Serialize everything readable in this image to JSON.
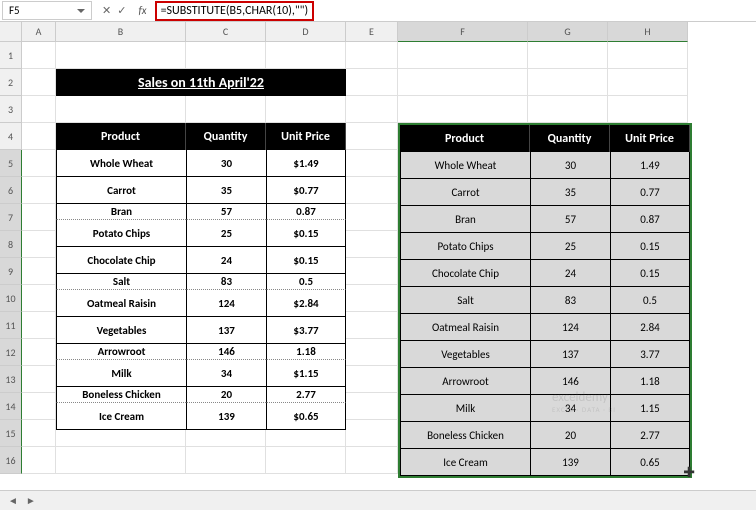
{
  "namebox": {
    "value": "F5"
  },
  "formula_bar": {
    "fx_label": "fx",
    "formula": "=SUBSTITUTE(B5,CHAR(10),\"\")"
  },
  "columns": [
    "A",
    "B",
    "C",
    "D",
    "E",
    "F",
    "G",
    "H"
  ],
  "rows": [
    "1",
    "2",
    "3",
    "4",
    "5",
    "6",
    "7",
    "8",
    "9",
    "10",
    "11",
    "12",
    "13",
    "14",
    "15",
    "16"
  ],
  "title": "Sales on 11th April'22",
  "table1": {
    "headers": {
      "product": "Product",
      "quantity": "Quantity",
      "unitprice": "Unit Price"
    },
    "rows": [
      {
        "p": "Whole Wheat",
        "q": "30",
        "u": "$1.49"
      },
      {
        "p": "Carrot",
        "q": "35",
        "u": "$0.77"
      },
      {
        "p": "Bran",
        "q": "57",
        "u": "0.87",
        "squish": true
      },
      {
        "p": "Potato Chips",
        "q": "25",
        "u": "$0.15"
      },
      {
        "p": "Chocolate Chip",
        "q": "24",
        "u": "$0.15"
      },
      {
        "p": "Salt",
        "q": "83",
        "u": "0.5",
        "squish": true
      },
      {
        "p": "Oatmeal Raisin",
        "q": "124",
        "u": "$2.84"
      },
      {
        "p": "Vegetables",
        "q": "137",
        "u": "$3.77"
      },
      {
        "p": "Arrowroot",
        "q": "146",
        "u": "1.18",
        "squish": true
      },
      {
        "p": "Milk",
        "q": "34",
        "u": "$1.15"
      },
      {
        "p": "Boneless Chicken",
        "q": "20",
        "u": "2.77",
        "squish": true
      },
      {
        "p": "Ice Cream",
        "q": "139",
        "u": "$0.65"
      }
    ]
  },
  "table2": {
    "headers": {
      "product": "Product",
      "quantity": "Quantity",
      "unitprice": "Unit Price"
    },
    "rows": [
      {
        "p": "Whole Wheat",
        "q": "30",
        "u": "1.49"
      },
      {
        "p": "Carrot",
        "q": "35",
        "u": "0.77"
      },
      {
        "p": "Bran",
        "q": "57",
        "u": "0.87"
      },
      {
        "p": "Potato Chips",
        "q": "25",
        "u": "0.15"
      },
      {
        "p": "Chocolate Chip",
        "q": "24",
        "u": "0.15"
      },
      {
        "p": "Salt",
        "q": "83",
        "u": "0.5"
      },
      {
        "p": "Oatmeal Raisin",
        "q": "124",
        "u": "2.84"
      },
      {
        "p": "Vegetables",
        "q": "137",
        "u": "3.77"
      },
      {
        "p": "Arrowroot",
        "q": "146",
        "u": "1.18"
      },
      {
        "p": "Milk",
        "q": "34",
        "u": "1.15"
      },
      {
        "p": "Boneless Chicken",
        "q": "20",
        "u": "2.77"
      },
      {
        "p": "Ice Cream",
        "q": "139",
        "u": "0.65"
      }
    ]
  },
  "watermark": {
    "main": "exceldemy",
    "sub": "EXCEL · DATA · BI"
  },
  "chart_data": {
    "type": "table",
    "title": "Sales on 11th April'22",
    "columns": [
      "Product",
      "Quantity",
      "Unit Price"
    ],
    "rows": [
      [
        "Whole Wheat",
        30,
        1.49
      ],
      [
        "Carrot",
        35,
        0.77
      ],
      [
        "Bran",
        57,
        0.87
      ],
      [
        "Potato Chips",
        25,
        0.15
      ],
      [
        "Chocolate Chip",
        24,
        0.15
      ],
      [
        "Salt",
        83,
        0.5
      ],
      [
        "Oatmeal Raisin",
        124,
        2.84
      ],
      [
        "Vegetables",
        137,
        3.77
      ],
      [
        "Arrowroot",
        146,
        1.18
      ],
      [
        "Milk",
        34,
        1.15
      ],
      [
        "Boneless Chicken",
        20,
        2.77
      ],
      [
        "Ice Cream",
        139,
        0.65
      ]
    ]
  }
}
